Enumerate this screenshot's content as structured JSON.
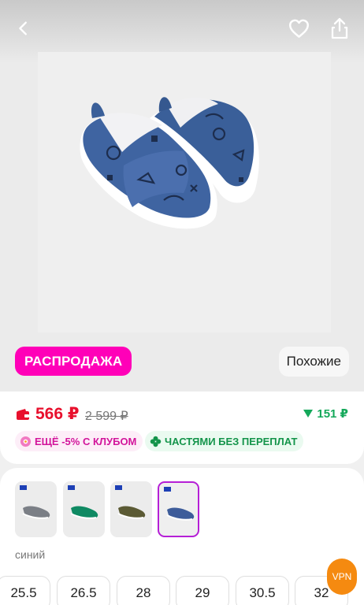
{
  "header": {
    "back_icon": "chevron-left-icon",
    "favorite_icon": "heart-icon",
    "share_icon": "share-icon"
  },
  "product": {
    "image_subject": "blue children's slip-on shoes",
    "sale_badge": "РАСПРОДАЖА",
    "similar_button": "Похожие"
  },
  "price": {
    "current": "566 ₽",
    "old": "2 599 ₽",
    "bonus": "151 ₽",
    "chips": [
      {
        "label": "ЕЩЁ -5% С КЛУБОМ",
        "icon": "club-icon"
      },
      {
        "label": "ЧАСТЯМИ БЕЗ ПЕРЕПЛАТ",
        "icon": "clover-icon"
      }
    ]
  },
  "variants": {
    "colors": [
      {
        "name": "gray",
        "hex": "#7b7f86"
      },
      {
        "name": "green",
        "hex": "#0f8a63"
      },
      {
        "name": "olive",
        "hex": "#5b5a34"
      },
      {
        "name": "blue",
        "hex": "#3d5c9a",
        "selected": true
      }
    ],
    "selected_color_label": "синий",
    "sizes": [
      "25.5",
      "26.5",
      "28",
      "29",
      "30.5",
      "32"
    ]
  },
  "overlay": {
    "vpn_label": "VPN"
  },
  "colors": {
    "sale": "#ff00b8",
    "price": "#e8102d",
    "bonus": "#14a85a",
    "selected_outline": "#b51fd6",
    "vpn": "#f58a10"
  }
}
